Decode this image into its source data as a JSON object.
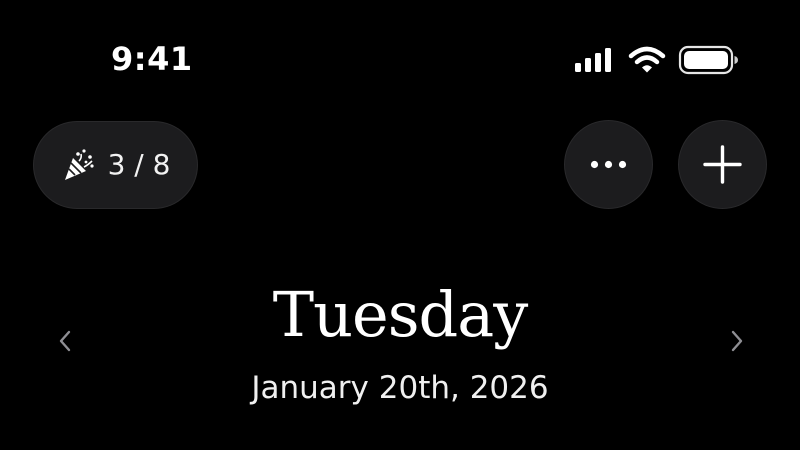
{
  "status_bar": {
    "time": "9:41",
    "icons": [
      "cellular-signal-icon",
      "wifi-icon",
      "battery-icon"
    ]
  },
  "toolbar": {
    "progress_icon": "party-popper-icon",
    "progress_label": "3 / 8",
    "progress_completed": 3,
    "progress_total": 8,
    "more_icon": "ellipsis-icon",
    "add_icon": "plus-icon"
  },
  "day_header": {
    "weekday": "Tuesday",
    "date": "January 20th, 2026",
    "prev_icon": "chevron-left-icon",
    "next_icon": "chevron-right-icon"
  },
  "colors": {
    "background": "#000000",
    "button_fill": "#1c1c1e",
    "text": "#ffffff",
    "chevron": "#8e8e93"
  }
}
